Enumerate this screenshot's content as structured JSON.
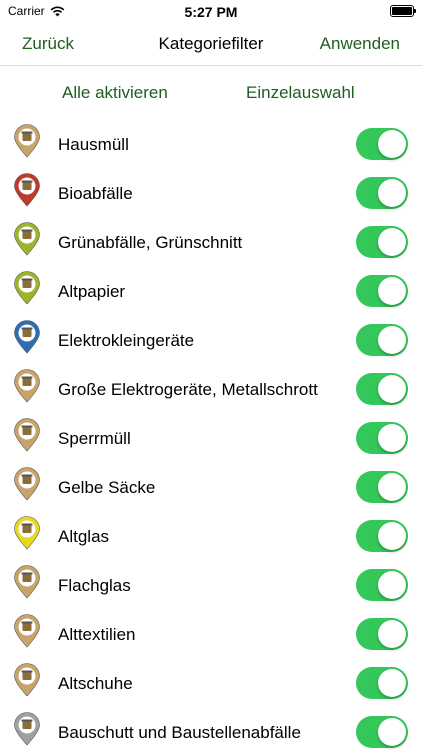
{
  "status": {
    "carrier": "Carrier",
    "time": "5:27 PM"
  },
  "nav": {
    "back": "Zurück",
    "title": "Kategoriefilter",
    "apply": "Anwenden"
  },
  "actions": {
    "all": "Alle aktivieren",
    "single": "Einzelauswahl"
  },
  "colors": {
    "accent": "#1f5e1f",
    "toggle_on": "#34c759"
  },
  "categories": [
    {
      "label": "Hausmüll",
      "icon": "trash-bin-pin-icon",
      "pin_color": "#c8a46a",
      "enabled": true
    },
    {
      "label": "Bioabfälle",
      "icon": "bio-waste-pin-icon",
      "pin_color": "#c0392b",
      "enabled": true
    },
    {
      "label": "Grünabfälle, Grünschnitt",
      "icon": "green-waste-pin-icon",
      "pin_color": "#9cb52c",
      "enabled": true
    },
    {
      "label": "Altpapier",
      "icon": "paper-pin-icon",
      "pin_color": "#9cb52c",
      "enabled": true
    },
    {
      "label": "Elektrokleingeräte",
      "icon": "small-electronics-pin-icon",
      "pin_color": "#2e6db4",
      "enabled": true
    },
    {
      "label": "Große Elektrogeräte, Metallschrott",
      "icon": "large-electronics-pin-icon",
      "pin_color": "#c8a46a",
      "enabled": true
    },
    {
      "label": "Sperrmüll",
      "icon": "bulky-waste-pin-icon",
      "pin_color": "#c8a46a",
      "enabled": true
    },
    {
      "label": "Gelbe Säcke",
      "icon": "yellow-bag-pin-icon",
      "pin_color": "#c8a46a",
      "enabled": true
    },
    {
      "label": "Altglas",
      "icon": "glass-pin-icon",
      "pin_color": "#e8d81e",
      "enabled": true
    },
    {
      "label": "Flachglas",
      "icon": "flat-glass-pin-icon",
      "pin_color": "#c8a46a",
      "enabled": true
    },
    {
      "label": "Alttextilien",
      "icon": "textiles-pin-icon",
      "pin_color": "#c8a46a",
      "enabled": true
    },
    {
      "label": "Altschuhe",
      "icon": "shoes-pin-icon",
      "pin_color": "#c8a46a",
      "enabled": true
    },
    {
      "label": "Bauschutt und Baustellenabfälle",
      "icon": "construction-waste-pin-icon",
      "pin_color": "#a0a0a0",
      "enabled": true
    }
  ]
}
